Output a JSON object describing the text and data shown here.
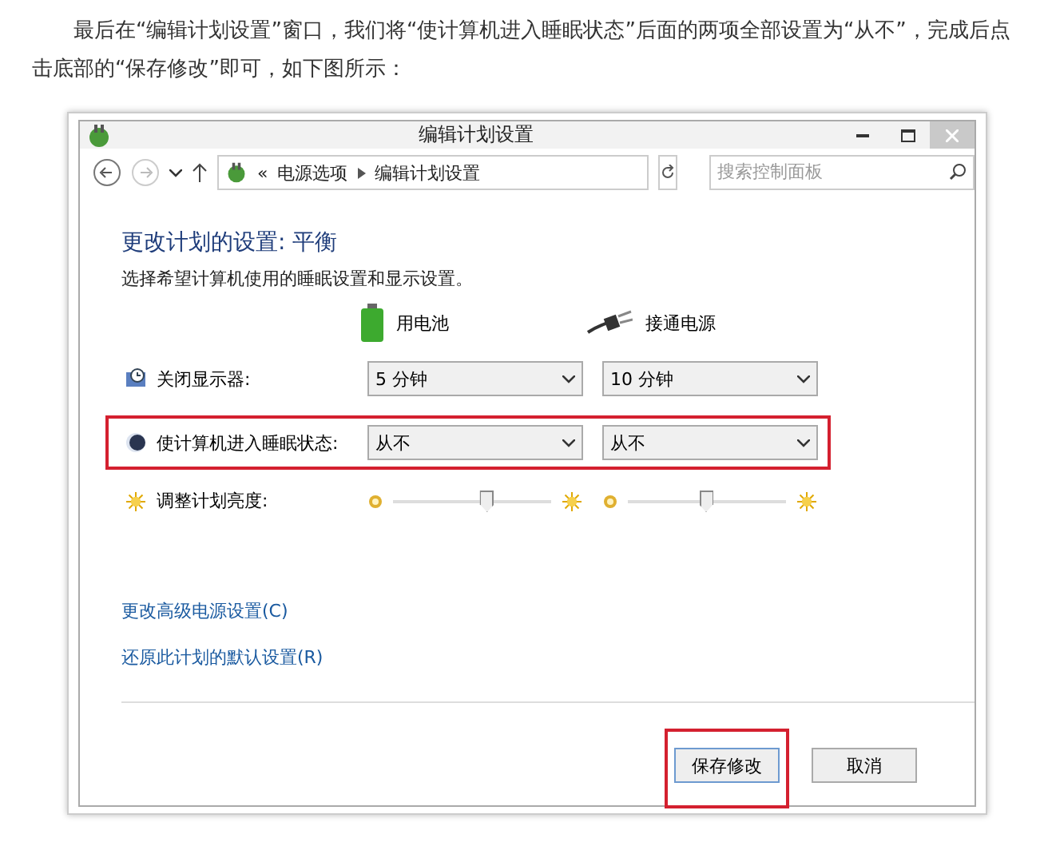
{
  "article": {
    "paragraph": "最后在“编辑计划设置”窗口，我们将“使计算机进入睡眠状态”后面的两项全部设置为“从不”，完成后点击底部的“保存修改”即可，如下图所示："
  },
  "window": {
    "title": "编辑计划设置"
  },
  "address_bar": {
    "overflow": "«",
    "crumbs": [
      "电源选项",
      "编辑计划设置"
    ],
    "search_placeholder": "搜索控制面板"
  },
  "heading": "更改计划的设置: 平衡",
  "subtitle": "选择希望计算机使用的睡眠设置和显示设置。",
  "columns": [
    "用电池",
    "接通电源"
  ],
  "settings": [
    {
      "kind": "dropdowns",
      "label": "关闭显示器:",
      "highlighted": false,
      "values": [
        "5 分钟",
        "10 分钟"
      ]
    },
    {
      "kind": "dropdowns",
      "label": "使计算机进入睡眠状态:",
      "highlighted": true,
      "values": [
        "从不",
        "从不"
      ]
    },
    {
      "kind": "sliders",
      "label": "调整计划亮度:",
      "highlighted": false,
      "levels": [
        {
          "level": 0.59
        },
        {
          "level": 0.49
        }
      ]
    }
  ],
  "links": [
    "更改高级电源设置(C)",
    "还原此计划的默认设置(R)"
  ],
  "buttons": [
    {
      "label": "保存修改",
      "highlighted": true
    },
    {
      "label": "取消",
      "highlighted": false
    }
  ]
}
